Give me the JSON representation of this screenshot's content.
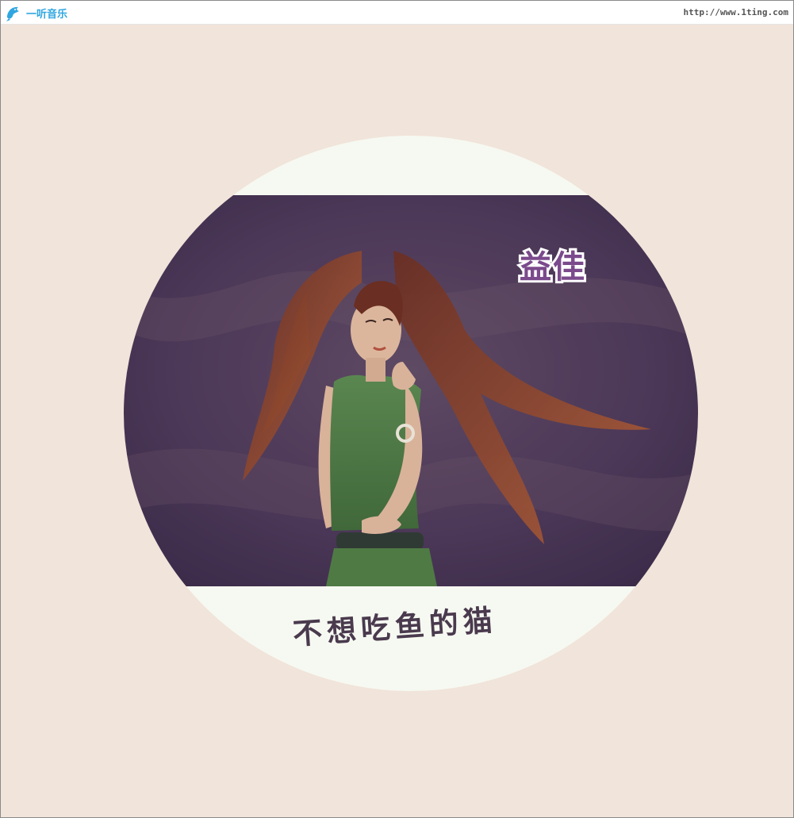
{
  "header": {
    "logo_text": "一听音乐",
    "logo_icon": "dolphin-icon",
    "url": "http://www.1ting.com"
  },
  "cover": {
    "artist": "益佳",
    "title": "不想吃鱼的猫"
  },
  "colors": {
    "background": "#f1e4da",
    "disc": "#f6f9f1",
    "accent": "#2fa6e0",
    "title_text": "#4a3a4e",
    "photo_backdrop": "#4e3a5a",
    "dress": "#4f7a44",
    "hair": "#9a4a2a"
  }
}
